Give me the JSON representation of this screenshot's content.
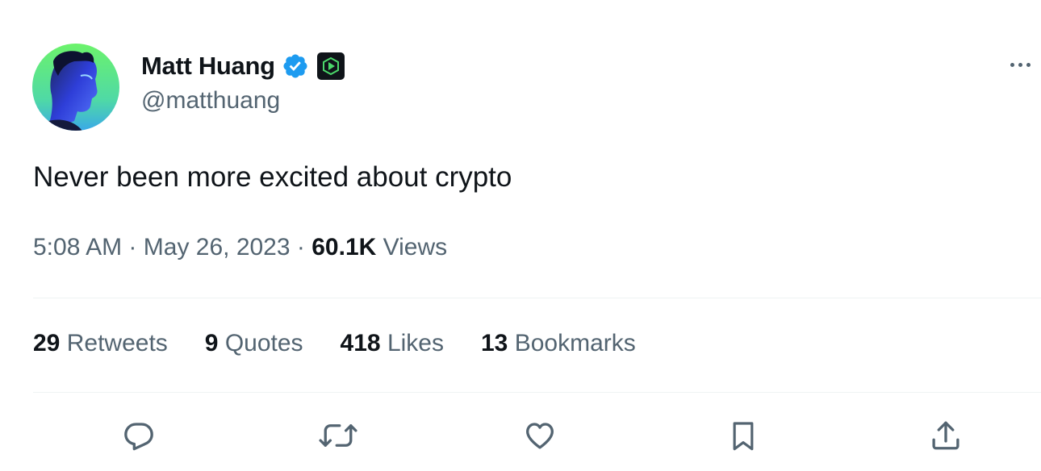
{
  "author": {
    "display_name": "Matt Huang",
    "handle": "@matthuang"
  },
  "icons": {
    "verified": "verified-badge-icon",
    "affiliate": "affiliate-logo-icon",
    "more": "more-options-icon",
    "reply": "reply-icon",
    "retweet": "retweet-icon",
    "like": "heart-icon",
    "bookmark": "bookmark-icon",
    "share": "share-icon"
  },
  "tweet": {
    "text": "Never been more excited about crypto",
    "time": "5:08 AM",
    "separator": "·",
    "date": "May 26, 2023",
    "views_count": "60.1K",
    "views_label": "Views"
  },
  "stats": [
    {
      "count": "29",
      "label": "Retweets"
    },
    {
      "count": "9",
      "label": "Quotes"
    },
    {
      "count": "418",
      "label": "Likes"
    },
    {
      "count": "13",
      "label": "Bookmarks"
    }
  ],
  "colors": {
    "text_primary": "#0f1419",
    "text_secondary": "#536471",
    "verified_blue": "#1d9bf0",
    "divider": "#eff3f4",
    "avatar_green": "#5ee86a",
    "avatar_blue": "#2f3fd6"
  }
}
